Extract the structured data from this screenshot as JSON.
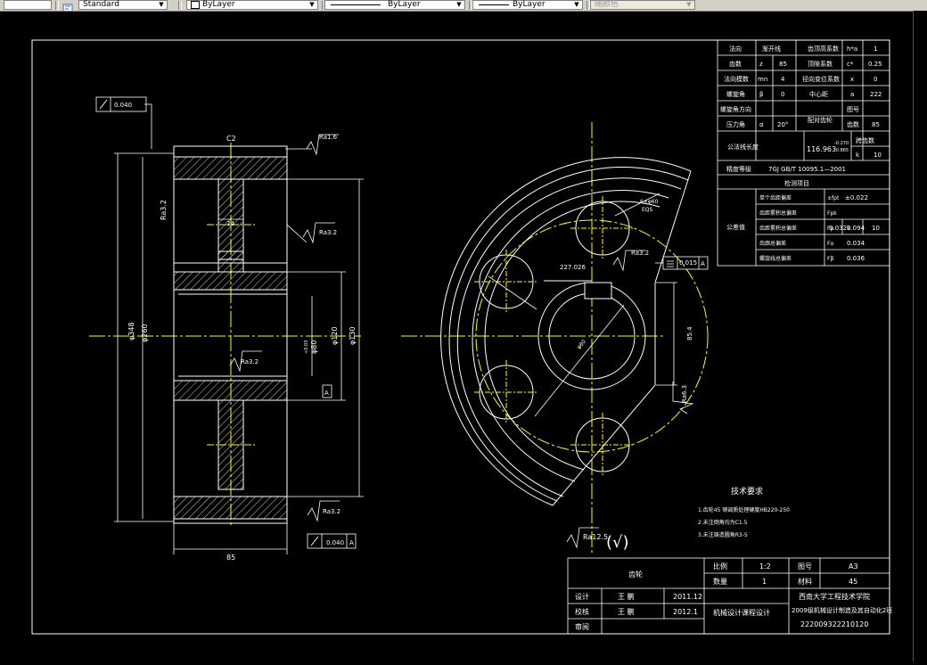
{
  "toolbar": {
    "text_style": "Standard",
    "layer_color": "ByLayer",
    "linetype": "ByLayer",
    "lineweight": "ByLayer",
    "plot_style": "随颜色"
  },
  "drawing": {
    "tech_req_title": "技术要求",
    "tech_req_items": [
      "1.齿轮45 钢调质处理硬度HB220-250",
      "2.未注倒角均为C1.5",
      "3.未注铸造圆角R3-5"
    ],
    "roughness_general": "Ra12.5",
    "roughness_general_symbol": "(√)",
    "left_view": {
      "dim_top_label": "C2",
      "dim_bottom": "85",
      "dim_hub": "24",
      "dim_outer": "φ348",
      "dim_root": "φ260",
      "dim_bore1": "φ80",
      "dim_bore1_tol": "+0.03",
      "dim_bore2": "φ120",
      "dim_bore3": "φ130",
      "ra_top": "Ra1.6",
      "ra_web": "Ra3.2",
      "ra_mid": "Ra3.2",
      "ra_left": "Ra3.2",
      "ra_bottom": "Ra3.2",
      "tol_top": "0.040",
      "tol_top_datum": "A",
      "tol_bottom": "0.040",
      "tol_bottom_datum": "A",
      "datum": "A"
    },
    "right_view": {
      "hole_note1": "6×φ60",
      "hole_note2": "EQS",
      "dim_circle": "227.026",
      "ra_face": "Ra3.2",
      "tol_sym": "0.015",
      "tol_datum": "A",
      "dim_key": "85.4",
      "ra_key": "Ra6.3",
      "dim_bore": "φ80"
    },
    "gear_table": {
      "rows": [
        [
          "法向",
          "渐开线",
          "齿顶高系数",
          "h*a",
          "1"
        ],
        [
          "齿数",
          "z",
          "85",
          "顶隙系数",
          "c*",
          "0.25"
        ],
        [
          "法向模数",
          "mn",
          "4",
          "径向变位系数",
          "x",
          "0"
        ],
        [
          "螺旋角",
          "β",
          "0",
          "中心距",
          "a",
          "222"
        ],
        [
          "螺旋角方向",
          "",
          "",
          "配对齿轮",
          "图号",
          ""
        ],
        [
          "压力角",
          "α",
          "20°",
          "",
          "齿数",
          "85"
        ]
      ],
      "span_label": "公法线长度",
      "span_value": "116.963",
      "span_tol_upper": "-0.270",
      "span_tol_lower": "-0.865",
      "span_count_label": "跨齿数",
      "span_k": "k",
      "span_k_val": "10",
      "accuracy_label": "精度等级",
      "accuracy_value": "7GJ GB/T 10095.1—2001",
      "inspect_title": "检测项目",
      "inspect_side": "公差值",
      "inspect_rows": [
        [
          "单个齿距偏差",
          "±fpt",
          "±0.022"
        ],
        [
          "齿距累积总偏差",
          "Fpk",
          "0.032",
          "k",
          "10"
        ],
        [
          "齿距累积总偏差",
          "Fp",
          "0.094"
        ],
        [
          "齿廓总偏差",
          "Fα",
          "0.034"
        ],
        [
          "螺旋线总偏差",
          "Fβ",
          "0.036"
        ]
      ]
    },
    "title_block": {
      "part_name": "齿轮",
      "scale_label": "比例",
      "scale_value": "1:2",
      "drawing_no_label": "图号",
      "drawing_no": "A3",
      "qty_label": "数量",
      "qty_value": "1",
      "material_label": "材料",
      "material_value": "45",
      "designer_label": "设计",
      "designer": "王 鹏",
      "design_date": "2011.12",
      "checker_label": "校核",
      "checker": "王 鹏",
      "check_date": "2012.1",
      "approve_label": "审阅",
      "course": "机械设计课程设计",
      "school": "西南大学工程技术学院",
      "class": "2009级机械设计制造及其自动化2班",
      "student_no": "222009322210120"
    }
  }
}
